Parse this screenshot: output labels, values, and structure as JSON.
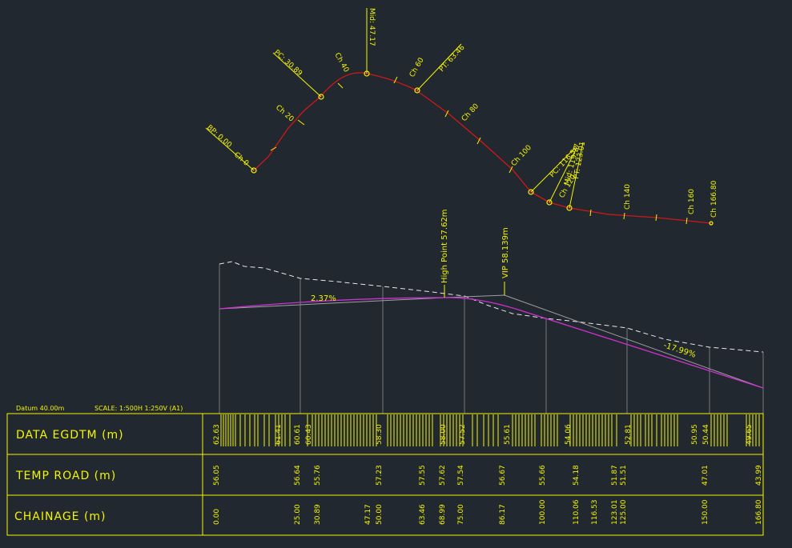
{
  "colors": {
    "background": "#212830",
    "yellow": "#f5f500",
    "red": "#d01818",
    "magenta": "#d030d0",
    "white": "#e8e8e8",
    "grey": "#a0a0a0"
  },
  "plan": {
    "labels": {
      "bp": "BP: 0.00",
      "ch0": "Ch 0",
      "ch20": "Ch 20",
      "pc1": "PC: 30.89",
      "ch40": "Ch 40",
      "mid": "Mid: 47.17",
      "ch60": "Ch 60",
      "pt1": "PT: 63.46",
      "ch80": "Ch 80",
      "ch100": "Ch 100",
      "pc2": "PC: 116.53",
      "ch120": "Ch 120",
      "mid2": "Mid: 119.77",
      "pt2": "PT: 123.01",
      "ch140": "Ch 140",
      "ch160": "Ch 160",
      "ch166": "Ch 166.80"
    }
  },
  "profile": {
    "grade_left": "2.37%",
    "grade_right": "-17.99%",
    "high_point": "High Point 57.62m",
    "vip": "VIP 58.139m",
    "datum": "Datum 40.00m",
    "scale": "SCALE: 1:500H 1:250V (A1)"
  },
  "table": {
    "rows": [
      "DATA EGDTM (m)",
      "TEMP ROAD (m)",
      "CHAINAGE (m)"
    ],
    "egdtm_values": [
      "62.63",
      "61.41",
      "60.61",
      "60.43",
      "58.30",
      "58.00",
      "57.52",
      "55.61",
      "54.06",
      "52.81",
      "50.95",
      "50.44",
      "49.65"
    ],
    "road_values": [
      "56.05",
      "56.64",
      "55.76",
      "57.23",
      "57.55",
      "57.62",
      "57.54",
      "56.67",
      "55.66",
      "54.18",
      "51.87",
      "51.51",
      "47.01",
      "43.99"
    ],
    "chainage_values": [
      "0.00",
      "25.00",
      "30.89",
      "47.17",
      "50.00",
      "63.46",
      "68.99",
      "75.00",
      "86.17",
      "100.00",
      "110.06",
      "116.53",
      "123.01",
      "125.00",
      "150.00",
      "166.80"
    ]
  }
}
